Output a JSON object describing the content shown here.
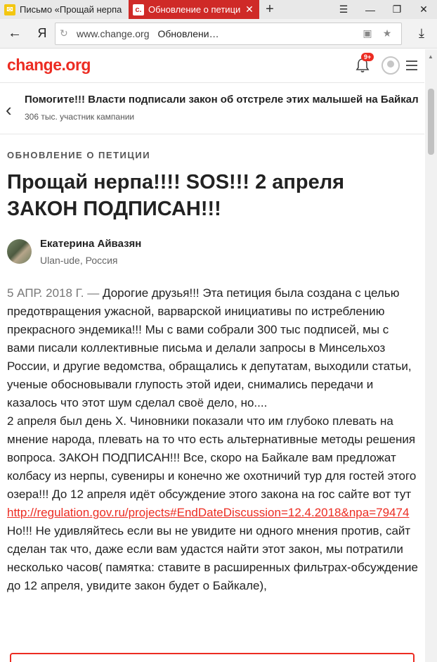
{
  "browser": {
    "tabs": [
      {
        "title": "Письмо «Прощай нерпа",
        "favicon": "mail-icon",
        "active": false
      },
      {
        "title": "Обновление о петици",
        "favicon": "change-icon",
        "active": true
      }
    ],
    "url_host": "www.change.org",
    "url_title": "Обновлени…",
    "yandex_label": "Я"
  },
  "site": {
    "logo": "change.org",
    "notification_badge": "9+"
  },
  "petition": {
    "title": "Помогите!!! Власти подписали закон об отстреле этих малышей на Байкале!!!",
    "participants": "306 тыс. участник кампании"
  },
  "article": {
    "kicker": "ОБНОВЛЕНИЕ О ПЕТИЦИИ",
    "headline": "Прощай нерпа!!!! SOS!!! 2 апреля ЗАКОН ПОДПИСАН!!!",
    "author_name": "Екатерина Айвазян",
    "author_location": "Ulan-ude, Россия",
    "date": "5 АПР. 2018 Г. —",
    "paragraph1": "Дорогие друзья!!! Эта петиция была создана с целью предотвращения ужасной, варварской инициативы по истреблению прекрасного эндемика!!! Мы с вами собрали 300 тыс подписей, мы с вами писали коллективные письма и делали запросы в Минсельхоз России, и другие ведомства, обращались к депутатам, выходили статьи, ученые обосновывали глупость этой идеи, снимались передачи и казалось что этот шум сделал своё дело, но....",
    "paragraph2": "2 апреля был день Х. Чиновники показали что им глубоко плевать на мнение народа, плевать на то что есть альтернативные методы решения вопроса. ЗАКОН ПОДПИСАН!!! Все, скоро на Байкале вам предложат колбасу из нерпы, сувениры и конечно же охотничий тур для гостей этого озера!!! До 12 апреля идёт обсуждение этого закона на гос сайте вот тут",
    "link": "http://regulation.gov.ru/projects#EndDateDiscussion=12.4.2018&npa=79474",
    "paragraph3": "Но!!! Не удивляйтесь если вы не увидите ни одного мнения против, сайт сделан так что, даже если вам удастся найти этот закон, мы потратили несколько часов( памятка: ставите в расширенных фильтрах-обсуждение до 12 апреля, увидите закон будет о Байкале),"
  },
  "colors": {
    "brand": "#ec2c22",
    "active_tab": "#cf2a27"
  }
}
